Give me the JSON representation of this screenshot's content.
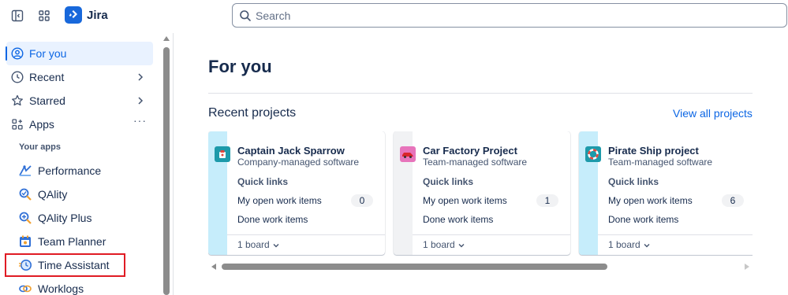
{
  "app": {
    "name": "Jira"
  },
  "search": {
    "placeholder": "Search"
  },
  "sidebar": {
    "nav": [
      {
        "label": "For you",
        "icon": "user-circle-icon",
        "active": true
      },
      {
        "label": "Recent",
        "icon": "clock-icon"
      },
      {
        "label": "Starred",
        "icon": "star-icon"
      },
      {
        "label": "Apps",
        "icon": "apps-icon"
      }
    ],
    "section_label": "Your apps",
    "apps": [
      {
        "label": "Performance",
        "icon": "performance-icon"
      },
      {
        "label": "QAlity",
        "icon": "qality-icon"
      },
      {
        "label": "QAlity Plus",
        "icon": "qality-plus-icon"
      },
      {
        "label": "Team Planner",
        "icon": "team-planner-icon"
      },
      {
        "label": "Time Assistant",
        "icon": "time-assistant-icon"
      },
      {
        "label": "Worklogs",
        "icon": "worklogs-icon"
      }
    ]
  },
  "main": {
    "title": "For you",
    "recent_projects": {
      "heading": "Recent projects",
      "view_all": "View all projects",
      "cards": [
        {
          "name": "Captain Jack Sparrow",
          "type": "Company-managed software",
          "quick_links": "Quick links",
          "open_items": "My open work items",
          "open_count": "0",
          "done_items": "Done work items",
          "board": "1 board",
          "strip_color": "#c6edfb",
          "icon_color": "#1d9aaa"
        },
        {
          "name": "Car Factory Project",
          "type": "Team-managed software",
          "quick_links": "Quick links",
          "open_items": "My open work items",
          "open_count": "1",
          "done_items": "Done work items",
          "board": "1 board",
          "strip_color": "#f1f2f4",
          "icon_color": "#e774bb"
        },
        {
          "name": "Pirate Ship project",
          "type": "Team-managed software",
          "quick_links": "Quick links",
          "open_items": "My open work items",
          "open_count": "6",
          "done_items": "Done work items",
          "board": "1 board",
          "strip_color": "#c6edfb",
          "icon_color": "#1d9aaa"
        }
      ]
    }
  },
  "colors": {
    "accent": "#0c66e4",
    "logo": "#1868db",
    "highlight": "#e01b24"
  }
}
